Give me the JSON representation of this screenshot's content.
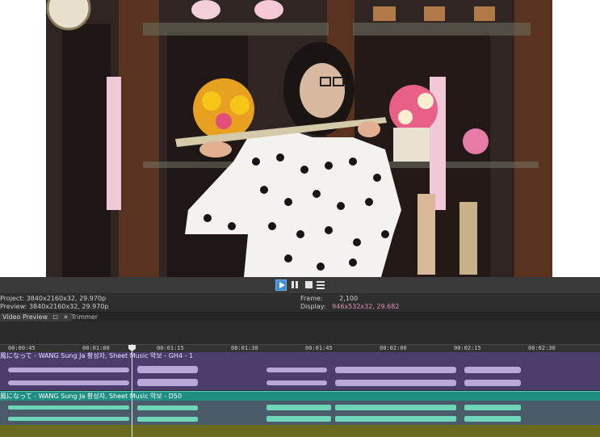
{
  "transport": {
    "play": "play-button",
    "pause": "pause-button",
    "stop": "stop-button",
    "menu": "menu-button"
  },
  "info": {
    "project": "Project:  3840x2160x32, 29.970p",
    "preview": "Preview: 3840x2160x32, 29.970p",
    "frame_label": "Frame:",
    "frame_value": "2,100",
    "display_label": "Display:",
    "display_value": "946x532x32, 29.682"
  },
  "tabs": {
    "video_preview": "Video Preview",
    "trimmer": "Trimmer"
  },
  "ruler": {
    "labels": [
      "00:00:45",
      "00:01:00",
      "00:01:15",
      "00:01:30",
      "00:01:45",
      "00:02:00",
      "00:02:15",
      "00:02:30"
    ]
  },
  "tracks": {
    "track1_title": "風になって - WANG Sung Ja 황성자, Sheet Music 악보 - GH4 - 1",
    "track2_title": "風になって - WANG Sung Ja 황성자, Sheet Music 악보 - D50"
  },
  "colors": {
    "accent": "#3d8fd6",
    "track1": "#4c3d6d",
    "track2_header": "#1f8e83",
    "pink_text": "#e08fb0"
  }
}
